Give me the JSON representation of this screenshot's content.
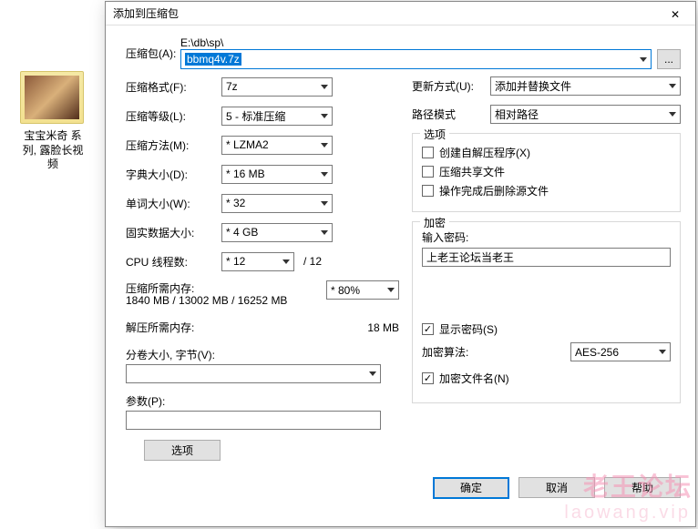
{
  "desktop": {
    "folder_label": "宝宝米奇 系列, 露脸长视频"
  },
  "dialog": {
    "title": "添加到压缩包",
    "close_glyph": "✕",
    "archive_label": "压缩包(A):",
    "archive_path": "E:\\db\\sp\\",
    "archive_filename": "bbmq4v.7z",
    "browse_btn": "...",
    "left": {
      "format_label": "压缩格式(F):",
      "format_value": "7z",
      "level_label": "压缩等级(L):",
      "level_value": "5 - 标准压缩",
      "method_label": "压缩方法(M):",
      "method_value": "* LZMA2",
      "dict_label": "字典大小(D):",
      "dict_value": "* 16 MB",
      "word_label": "单词大小(W):",
      "word_value": "* 32",
      "solid_label": "固实数据大小:",
      "solid_value": "* 4 GB",
      "cpu_label": "CPU 线程数:",
      "cpu_value": "* 12",
      "cpu_total": "/ 12",
      "mem_compress_label": "压缩所需内存:",
      "mem_compress_value": "1840 MB / 13002 MB / 16252 MB",
      "mem_pct_value": "* 80%",
      "mem_decompress_label": "解压所需内存:",
      "mem_decompress_value": "18 MB",
      "split_label": "分卷大小, 字节(V):",
      "params_label": "参数(P):",
      "options_btn": "选项"
    },
    "right": {
      "update_label": "更新方式(U):",
      "update_value": "添加并替换文件",
      "pathmode_label": "路径模式",
      "pathmode_value": "相对路径",
      "options_legend": "选项",
      "sfx_label": "创建自解压程序(X)",
      "share_label": "压缩共享文件",
      "delete_label": "操作完成后删除源文件",
      "encrypt_legend": "加密",
      "password_label": "输入密码:",
      "password_value": "上老王论坛当老王",
      "showpw_label": "显示密码(S)",
      "enc_method_label": "加密算法:",
      "enc_method_value": "AES-256",
      "enc_names_label": "加密文件名(N)"
    },
    "buttons": {
      "ok": "确定",
      "cancel": "取消",
      "help": "帮助"
    }
  },
  "watermark": {
    "text1": "老王论坛",
    "text2": "laowang.vip"
  }
}
